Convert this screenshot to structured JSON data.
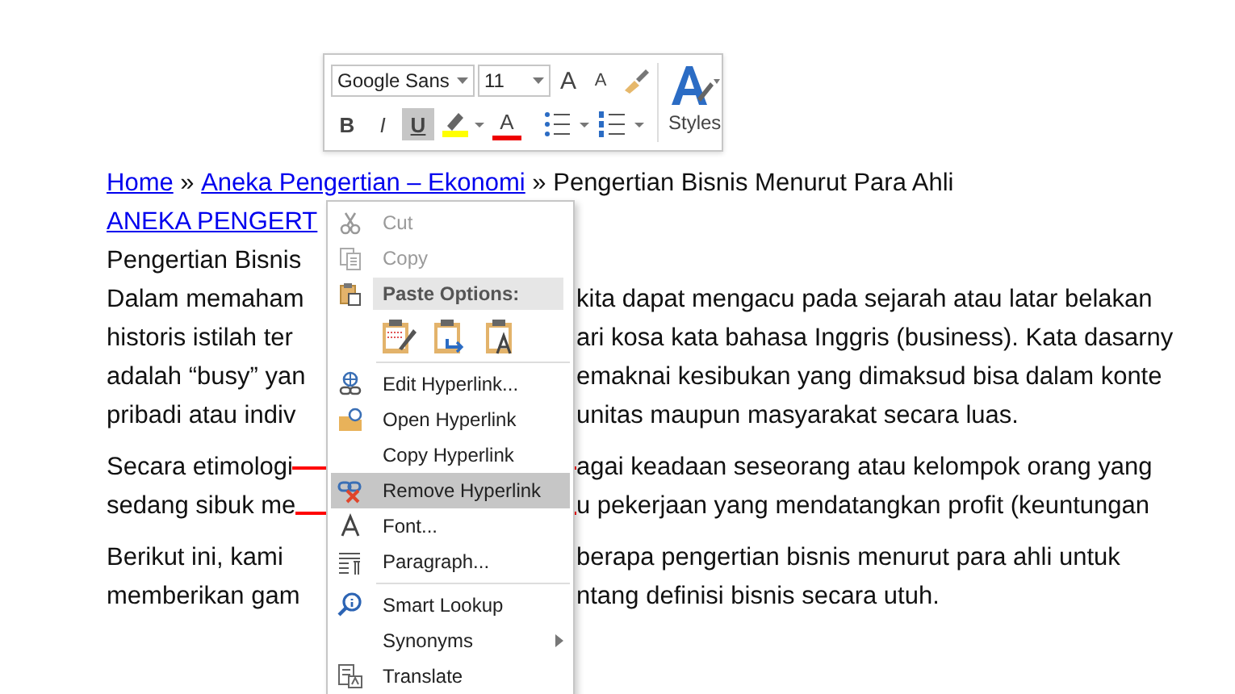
{
  "document": {
    "lines": [
      {
        "kind": "breadcrumb",
        "parts": [
          {
            "text": "Home",
            "kind": "link"
          },
          {
            "text": " » ",
            "kind": "text"
          },
          {
            "text": "Aneka Pengertian – Ekonomi",
            "kind": "link"
          },
          {
            "text": " » Pengertian Bisnis Menurut Para Ahli",
            "kind": "text"
          }
        ]
      },
      {
        "kind": "link",
        "left": "ANEKA PENGERT"
      },
      {
        "kind": "text",
        "left": "Pengertian Bisnis"
      },
      {
        "kind": "split",
        "left": "Dalam memaham",
        "right": "kita dapat mengacu pada sejarah atau latar belakan"
      },
      {
        "kind": "split",
        "left": "historis istilah ter",
        "right": "ari kosa kata bahasa Inggris (business). Kata dasarny"
      },
      {
        "kind": "split",
        "left": "adalah “busy” yan",
        "right": "emaknai kesibukan yang dimaksud bisa dalam konte"
      },
      {
        "kind": "split",
        "left": "pribadi atau indiv",
        "right": "unitas maupun masyarakat secara luas."
      },
      {
        "kind": "blank"
      },
      {
        "kind": "split",
        "left": "Secara etimologi",
        "right": "agai keadaan seseorang atau kelompok orang yang"
      },
      {
        "kind": "split",
        "left": "sedang sibuk me",
        "right": "u pekerjaan yang mendatangkan profit (keuntungan"
      },
      {
        "kind": "blank"
      },
      {
        "kind": "split",
        "left": "Berikut ini, kami",
        "right": "berapa pengertian bisnis menurut para ahli untuk"
      },
      {
        "kind": "split",
        "left": "memberikan gam",
        "right": "ntang definisi bisnis secara utuh."
      }
    ]
  },
  "mini_toolbar": {
    "font": "Google Sans",
    "size": "11",
    "grow": "A",
    "shrink": "A",
    "format_buttons": [
      {
        "label": "B",
        "kind": "bold",
        "selected": false
      },
      {
        "label": "I",
        "kind": "italic",
        "selected": false
      },
      {
        "label": "U",
        "kind": "underline",
        "selected": true
      }
    ],
    "font_color": "A",
    "styles": "Styles"
  },
  "context_menu": [
    {
      "kind": "item",
      "label": "Cut",
      "disabled": true,
      "selected": false
    },
    {
      "kind": "item",
      "label": "Copy",
      "disabled": true,
      "selected": false
    },
    {
      "kind": "header",
      "label": "Paste Options:"
    },
    {
      "kind": "paste-icons"
    },
    {
      "kind": "separator"
    },
    {
      "kind": "item",
      "label": "Edit Hyperlink...",
      "disabled": false,
      "selected": false
    },
    {
      "kind": "item",
      "label": "Open Hyperlink",
      "disabled": false,
      "selected": false
    },
    {
      "kind": "item",
      "label": "Copy Hyperlink",
      "disabled": false,
      "selected": false
    },
    {
      "kind": "item",
      "label": "Remove Hyperlink",
      "disabled": false,
      "selected": true
    },
    {
      "kind": "item",
      "label": "Font...",
      "disabled": false,
      "selected": false
    },
    {
      "kind": "item",
      "label": "Paragraph...",
      "disabled": false,
      "selected": false
    },
    {
      "kind": "separator"
    },
    {
      "kind": "item",
      "label": "Smart Lookup",
      "disabled": false,
      "selected": false
    },
    {
      "kind": "submenu",
      "label": "Synonyms",
      "disabled": false,
      "selected": false
    },
    {
      "kind": "item",
      "label": "Translate",
      "disabled": false,
      "selected": false
    }
  ],
  "annotations": [
    {
      "kind": "frame"
    }
  ]
}
